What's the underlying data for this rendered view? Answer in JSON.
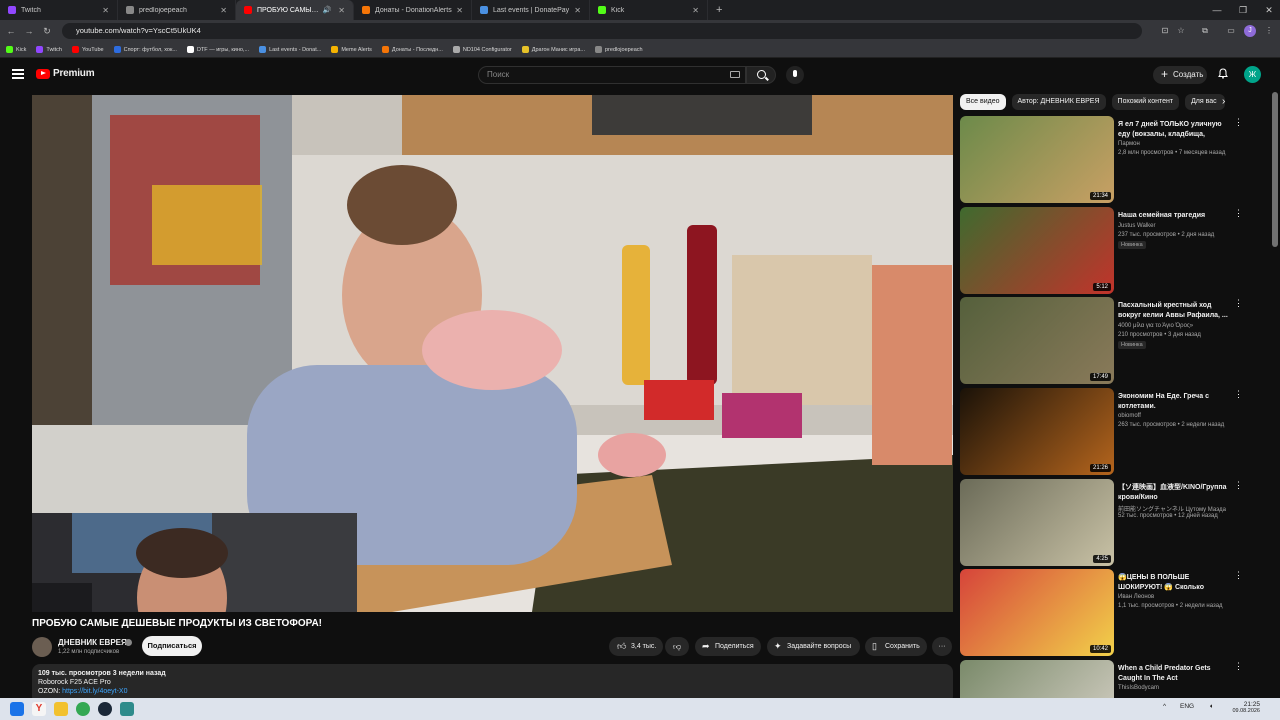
{
  "browser": {
    "tabs": [
      {
        "label": "Twitch",
        "favicon_color": "#9147ff",
        "active": false
      },
      {
        "label": "predlojoepeach",
        "favicon_color": "#888888",
        "active": false
      },
      {
        "label": "ПРОБУЮ САМЫЕ ДЕШЕВЫ",
        "favicon_color": "#ff0000",
        "active": true
      },
      {
        "label": "Донаты - DonationAlerts",
        "favicon_color": "#f57507",
        "active": false
      },
      {
        "label": "Last events | DonatePay",
        "favicon_color": "#4a90e2",
        "active": false
      },
      {
        "label": "Kick",
        "favicon_color": "#53fc18",
        "active": false
      }
    ],
    "url": "youtube.com/watch?v=YscCt5UkUK4",
    "bookmarks": [
      {
        "label": "Kick",
        "color": "#53fc18"
      },
      {
        "label": "Twitch",
        "color": "#9147ff"
      },
      {
        "label": "YouTube",
        "color": "#ff0000"
      },
      {
        "label": "Спорт: футбол, хок...",
        "color": "#2d6cdf"
      },
      {
        "label": "DTF — игры, кино,...",
        "color": "#ffffff"
      },
      {
        "label": "Last events - Donat...",
        "color": "#4a90e2"
      },
      {
        "label": "Meme Alerts",
        "color": "#f5b301"
      },
      {
        "label": "Донаты - Последн...",
        "color": "#f57507"
      },
      {
        "label": "ND104 Configurator",
        "color": "#aaaaaa"
      },
      {
        "label": "Драгон Манис игра...",
        "color": "#e6c229"
      },
      {
        "label": "predlojoepeach",
        "color": "#888888"
      }
    ],
    "profile_initial": "J"
  },
  "header": {
    "logo_text": "Premium",
    "search_placeholder": "Поиск",
    "create_label": "Создать",
    "avatar_initial": "Ж"
  },
  "video": {
    "title": "ПРОБУЮ САМЫЕ ДЕШЕВЫЕ ПРОДУКТЫ ИЗ СВЕТОФОРА!",
    "channel": "ДНЕВНИК ЕВРЕЯ",
    "subscribers": "1,22 млн подписчиков",
    "subscribe_label": "Подписаться",
    "likes": "3,4 тыс.",
    "share_label": "Поделиться",
    "ask_label": "Задавайте вопросы",
    "save_label": "Сохранить",
    "desc_stats": "109 тыс. просмотров  3 недели назад",
    "desc_line1": "Roborock F25 ACE Pro",
    "desc_line2_prefix": "OZON: ",
    "desc_line2_link": "https://bit.ly/4oeyt-X0"
  },
  "sidebar": {
    "chips": [
      "Все видео",
      "Автор: ДНЕВНИК ЕВРЕЯ",
      "Похожий контент",
      "Для вас"
    ],
    "recommendations": [
      {
        "title": "Я ел 7 дней ТОЛЬКО уличную еду (вокзалы, кладбища, рынки)",
        "channel": "Пармон",
        "meta": "2,8 млн просмотров • 7 месяцев назад",
        "duration": "21:34",
        "badge": "",
        "thumb_colors": [
          "#6c8a4a",
          "#c9a064"
        ]
      },
      {
        "title": "Наша семейная трагедия",
        "channel": "Justus Walker",
        "meta": "237 тыс. просмотров • 2 дня назад",
        "duration": "5:12",
        "badge": "Новинка",
        "thumb_colors": [
          "#3f6a2e",
          "#c2332b"
        ]
      },
      {
        "title": "Пасхальный крестный ход вокруг келии Аввы Рафаила, ...",
        "channel": "",
        "meta": "4000 μίλα για το Άγιο Όρος»",
        "meta2": "210 просмотров • 3 дня назад",
        "duration": "17:49",
        "badge": "Новинка",
        "thumb_colors": [
          "#55603c",
          "#8a7a5a"
        ]
      },
      {
        "title": "Экономим На Еде. Греча с котлетами.",
        "channel": "obiomoff",
        "meta": "263 тыс. просмотров • 2 недели назад",
        "duration": "21:26",
        "badge": "",
        "thumb_colors": [
          "#1a1208",
          "#b5651d"
        ]
      },
      {
        "title": "【ソ連映画】血液型/KINO/Группа крови/Кино",
        "channel": "前田能ソングチャンネル   Цутому Маэда",
        "meta": "52 тыс. просмотров • 12 дней назад",
        "duration": "4:25",
        "badge": "",
        "thumb_colors": [
          "#6b6b58",
          "#c9c2a6"
        ]
      },
      {
        "title": "😱ЦЕНЫ В ПОЛЬШЕ ШОКИРУЮТ! 😱 Сколько стоит...",
        "channel": "Иван Леонов",
        "meta": "1,1 тыс. просмотров • 2 недели назад",
        "duration": "10:42",
        "badge": "",
        "thumb_colors": [
          "#d6443a",
          "#f2d14a"
        ]
      },
      {
        "title": "When a Child Predator Gets Caught In The Act",
        "channel": "ThisIsBodycam",
        "meta": "",
        "duration": "",
        "badge": "",
        "thumb_colors": [
          "#7a8a6a",
          "#d8d2c8"
        ]
      }
    ]
  },
  "taskbar": {
    "lang": "ENG",
    "time": "21:25",
    "date": "09.08.2026"
  }
}
